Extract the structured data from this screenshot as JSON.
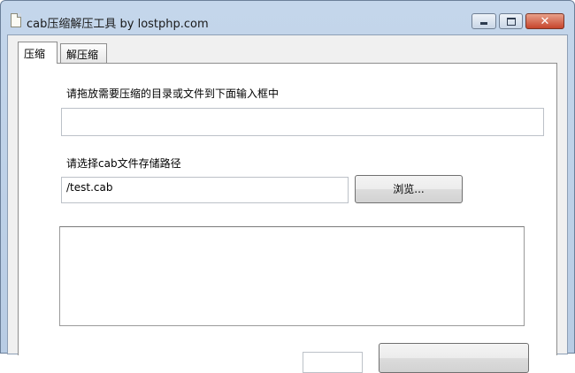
{
  "window": {
    "title": "cab压缩解压工具 by lostphp.com",
    "icon": "document-icon",
    "controls": {
      "minimize_icon": "minimize-icon",
      "maximize_icon": "maximize-icon",
      "close_icon": "close-icon",
      "close_glyph": "✕"
    }
  },
  "tabs": [
    {
      "label": "压缩",
      "active": true
    },
    {
      "label": "解压缩",
      "active": false
    }
  ],
  "compress_panel": {
    "source_label": "请拖放需要压缩的目录或文件到下面输入框中",
    "source_value": "",
    "dest_label": "请选择cab文件存储路径",
    "dest_value": "/test.cab",
    "browse_label": "浏览...",
    "log_text": ""
  },
  "colors": {
    "title_bar": "#c4d6eb",
    "close_button": "#c6452c",
    "panel_background": "#ffffff"
  }
}
